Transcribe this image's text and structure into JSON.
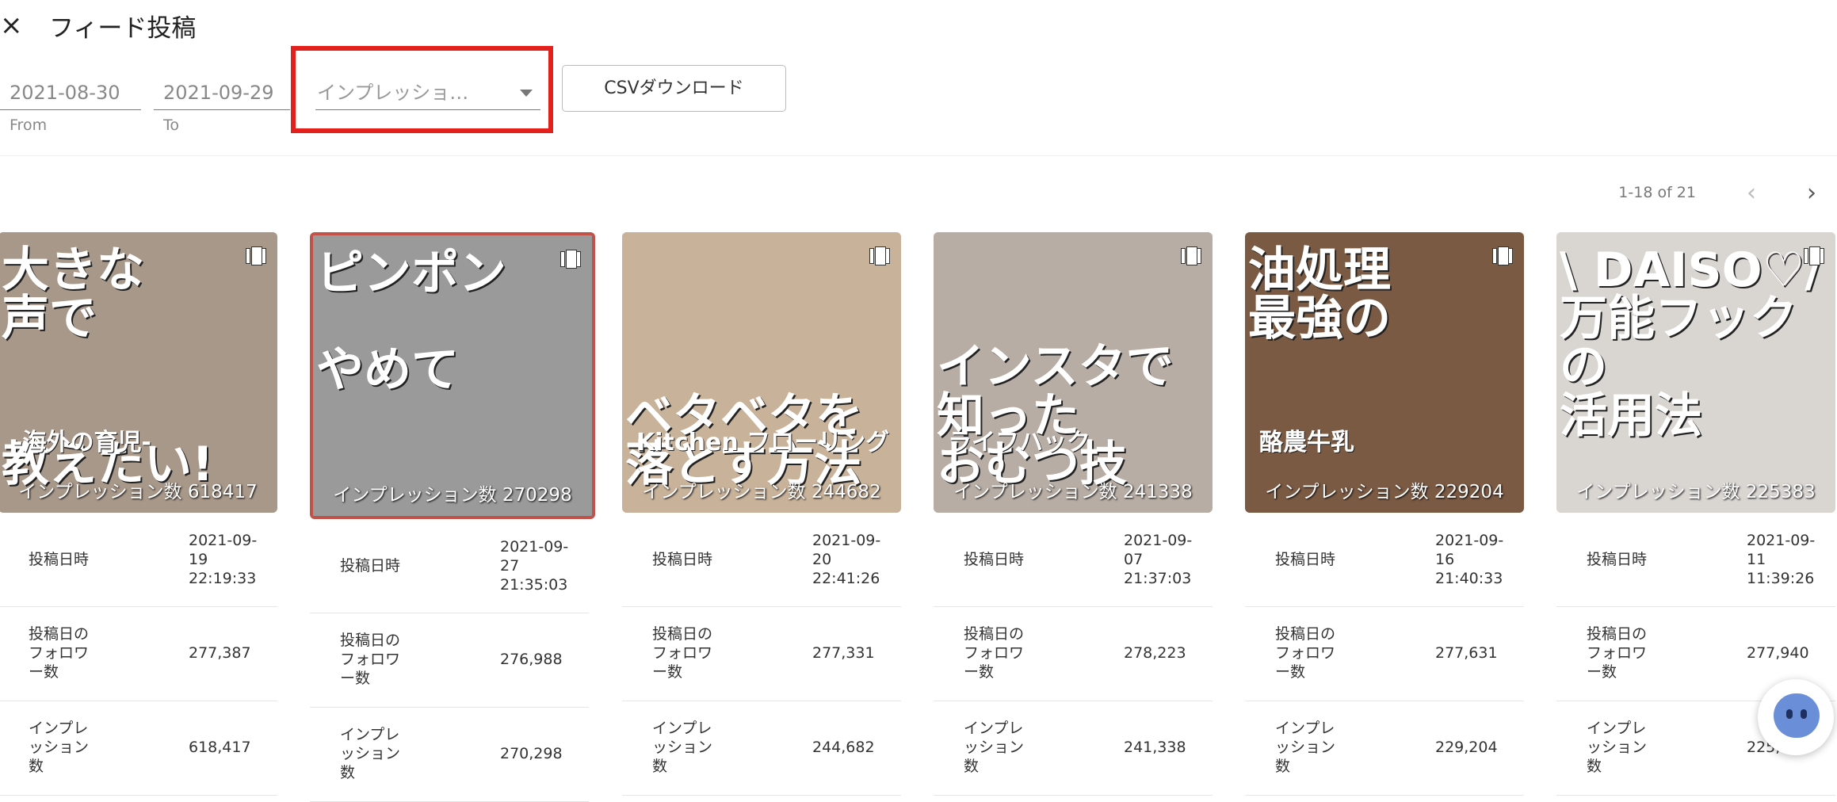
{
  "header": {
    "close_icon": "×",
    "title": "フィード投稿"
  },
  "filters": {
    "from_value": "2021-08-30",
    "from_label": "From",
    "to_value": "2021-09-29",
    "to_label": "To",
    "sort_value": "インプレッショ…",
    "csv_button": "CSVダウンロード"
  },
  "pager": {
    "range": "1-18 of 21",
    "prev": "‹",
    "next": "›"
  },
  "labels": {
    "posted_at": "投稿日時",
    "followers": "投稿日の\nフォロワ\nー数",
    "impressions": "インプレ\nッション\n数"
  },
  "posts": [
    {
      "caption": "大きな\n声で\n\n\n教えたい!",
      "sub": "-海外の育児-",
      "impression_overlay": "インプレッション数 618417",
      "posted_at": "2021-09-\n19\n22:19:33",
      "followers": "277,387",
      "impressions": "618,417",
      "color": "#a8988a"
    },
    {
      "caption": "ピンポン\n\nやめて",
      "sub": "",
      "impression_overlay": "インプレッション数 270298",
      "posted_at": "2021-09-\n27\n21:35:03",
      "followers": "276,988",
      "impressions": "270,298",
      "color": "#9a9a9a"
    },
    {
      "caption": "\n\n\nベタベタを\n落とす方法",
      "sub": "Kitchen フローリング",
      "impression_overlay": "インプレッション数 244682",
      "posted_at": "2021-09-\n20\n22:41:26",
      "followers": "277,331",
      "impressions": "244,682",
      "color": "#c8b29a"
    },
    {
      "caption": "\n\nインスタで知った\nおむつ技",
      "sub": "ライフハック",
      "impression_overlay": "インプレッション数 241338",
      "posted_at": "2021-09-\n07\n21:37:03",
      "followers": "278,223",
      "impressions": "241,338",
      "color": "#b7ada4"
    },
    {
      "caption": "油処理\n最強の",
      "sub": "酪農牛乳",
      "impression_overlay": "インプレッション数 229204",
      "posted_at": "2021-09-\n16\n21:40:33",
      "followers": "277,631",
      "impressions": "229,204",
      "color": "#7b5a44"
    },
    {
      "caption": "\\ DAISO♡/\n万能フックの\n活用法",
      "sub": "",
      "impression_overlay": "インプレッション数 225383",
      "posted_at": "2021-09-\n11\n11:39:26",
      "followers": "277,940",
      "impressions": "225,383",
      "color": "#d9d6d2"
    }
  ]
}
